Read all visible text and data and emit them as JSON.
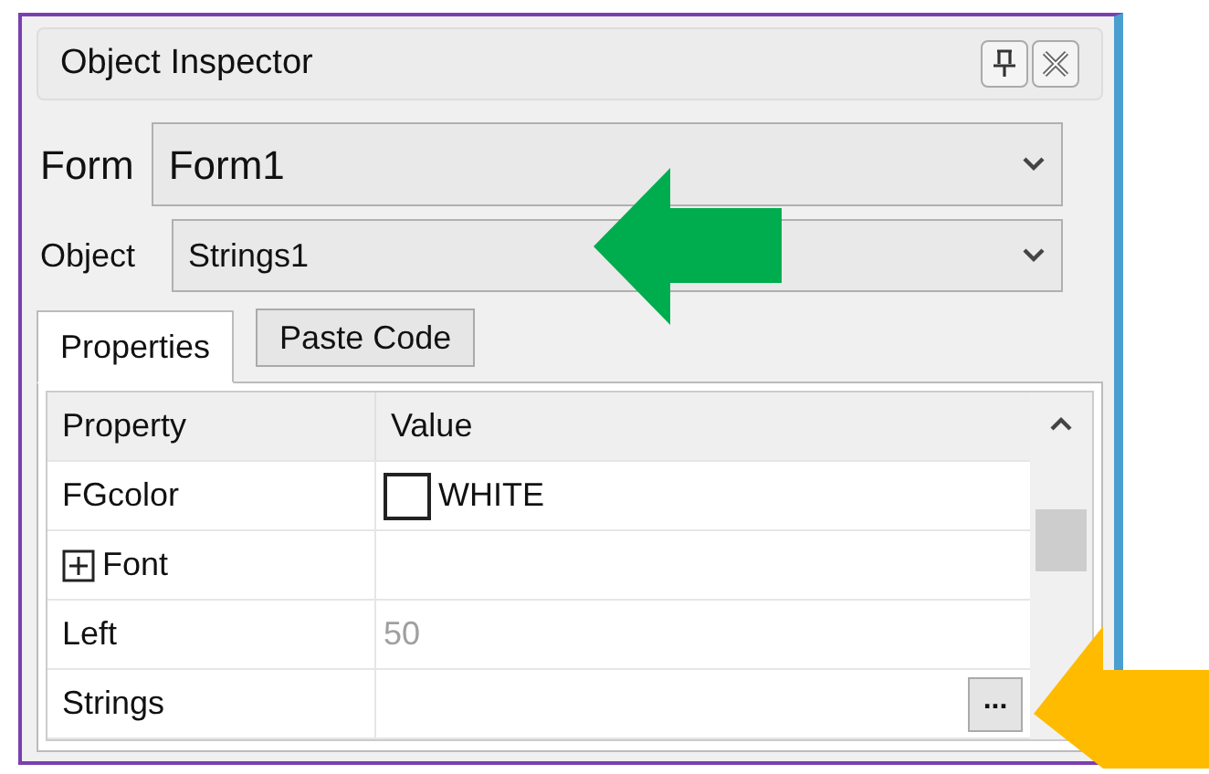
{
  "panel": {
    "title": "Object Inspector"
  },
  "form_selector": {
    "label": "Form",
    "value": "Form1"
  },
  "object_selector": {
    "label": "Object",
    "value": "Strings1"
  },
  "tabs": [
    {
      "label": "Properties",
      "selected": true
    },
    {
      "label": "Paste Code",
      "selected": false
    }
  ],
  "grid": {
    "columns": [
      "Property",
      "Value"
    ],
    "rows": [
      {
        "kind": "color",
        "name": "FGcolor",
        "value": "WHITE",
        "color": "#ffffff"
      },
      {
        "kind": "group",
        "name": "Font",
        "expanded": false
      },
      {
        "kind": "text",
        "name": "Left",
        "value": "50",
        "disabled": true
      },
      {
        "kind": "list",
        "name": "Strings",
        "button": "..."
      }
    ]
  }
}
